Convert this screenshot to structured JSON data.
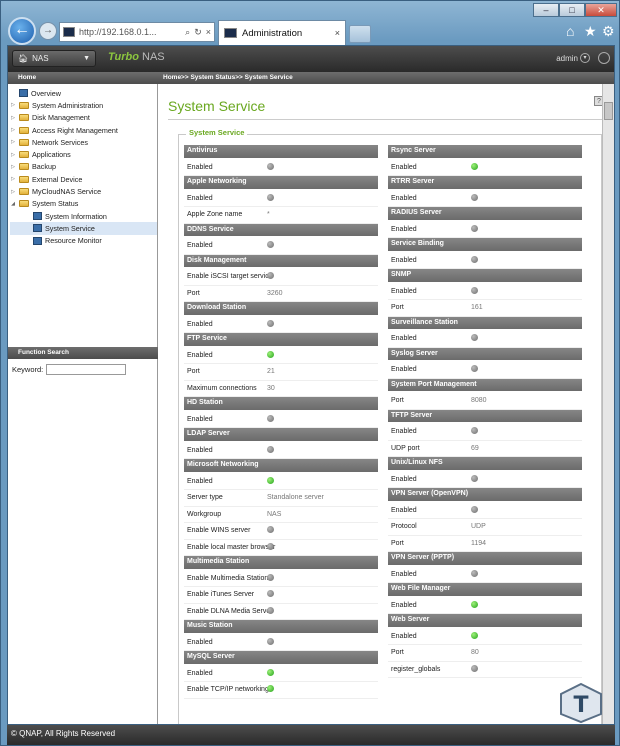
{
  "browser": {
    "address": "http://192.168.0.1...",
    "tab_title": "Administration",
    "tab_close": "×",
    "back": "←",
    "forward": "→",
    "reload": "↻",
    "search": "⌕",
    "addr_close": "×"
  },
  "header": {
    "nas_label": "NAS",
    "product_prefix": "Turbo",
    "product_name": "NAS",
    "user": "admin"
  },
  "breadcrumb": {
    "home": "Home",
    "path": "Home>> System Status>> System Service"
  },
  "sidebar": {
    "items": [
      {
        "label": "Overview",
        "tw": ""
      },
      {
        "label": "System Administration",
        "tw": "▷"
      },
      {
        "label": "Disk Management",
        "tw": "▷"
      },
      {
        "label": "Access Right Management",
        "tw": "▷"
      },
      {
        "label": "Network Services",
        "tw": "▷"
      },
      {
        "label": "Applications",
        "tw": "▷"
      },
      {
        "label": "Backup",
        "tw": "▷"
      },
      {
        "label": "External Device",
        "tw": "▷"
      },
      {
        "label": "MyCloudNAS Service",
        "tw": "▷"
      },
      {
        "label": "System Status",
        "tw": "◢"
      },
      {
        "label": "System Information",
        "tw": ""
      },
      {
        "label": "System Service",
        "tw": ""
      },
      {
        "label": "Resource Monitor",
        "tw": ""
      }
    ],
    "function_search": "Function Search",
    "keyword_label": "Keyword:"
  },
  "page": {
    "title": "System Service",
    "group_title": "System Service",
    "help": "?"
  },
  "left_sections": [
    {
      "title": "Antivirus",
      "rows": [
        {
          "label": "Enabled",
          "status": "off"
        }
      ]
    },
    {
      "title": "Apple Networking",
      "rows": [
        {
          "label": "Enabled",
          "status": "off"
        },
        {
          "label": "Apple Zone name",
          "value": "*"
        }
      ]
    },
    {
      "title": "DDNS Service",
      "rows": [
        {
          "label": "Enabled",
          "status": "off"
        }
      ]
    },
    {
      "title": "Disk Management",
      "rows": [
        {
          "label": "Enable iSCSI target service",
          "status": "off"
        },
        {
          "label": "Port",
          "value": "3260"
        }
      ]
    },
    {
      "title": "Download Station",
      "rows": [
        {
          "label": "Enabled",
          "status": "off"
        }
      ]
    },
    {
      "title": "FTP Service",
      "rows": [
        {
          "label": "Enabled",
          "status": "on"
        },
        {
          "label": "Port",
          "value": "21"
        },
        {
          "label": "Maximum connections",
          "value": "30"
        }
      ]
    },
    {
      "title": "HD Station",
      "rows": [
        {
          "label": "Enabled",
          "status": "off"
        }
      ]
    },
    {
      "title": "LDAP Server",
      "rows": [
        {
          "label": "Enabled",
          "status": "off"
        }
      ]
    },
    {
      "title": "Microsoft Networking",
      "rows": [
        {
          "label": "Enabled",
          "status": "on"
        },
        {
          "label": "Server type",
          "value": "Standalone server"
        },
        {
          "label": "Workgroup",
          "value": "NAS"
        },
        {
          "label": "Enable WINS server",
          "status": "off"
        },
        {
          "label": "Enable local master browser",
          "status": "off"
        }
      ]
    },
    {
      "title": "Multimedia Station",
      "rows": [
        {
          "label": "Enable Multimedia Station",
          "status": "off"
        },
        {
          "label": "Enable iTunes Server",
          "status": "off"
        },
        {
          "label": "Enable DLNA Media Server",
          "status": "off"
        }
      ]
    },
    {
      "title": "Music Station",
      "rows": [
        {
          "label": "Enabled",
          "status": "off"
        }
      ]
    },
    {
      "title": "MySQL Server",
      "rows": [
        {
          "label": "Enabled",
          "status": "on"
        },
        {
          "label": "Enable TCP/IP networking",
          "status": "on"
        }
      ]
    }
  ],
  "right_sections": [
    {
      "title": "Rsync Server",
      "rows": [
        {
          "label": "Enabled",
          "status": "on"
        }
      ]
    },
    {
      "title": "RTRR Server",
      "rows": [
        {
          "label": "Enabled",
          "status": "off"
        }
      ]
    },
    {
      "title": "RADIUS Server",
      "rows": [
        {
          "label": "Enabled",
          "status": "off"
        }
      ]
    },
    {
      "title": "Service Binding",
      "rows": [
        {
          "label": "Enabled",
          "status": "off"
        }
      ]
    },
    {
      "title": "SNMP",
      "rows": [
        {
          "label": "Enabled",
          "status": "off"
        },
        {
          "label": "Port",
          "value": "161"
        }
      ]
    },
    {
      "title": "Surveillance Station",
      "rows": [
        {
          "label": "Enabled",
          "status": "off"
        }
      ]
    },
    {
      "title": "Syslog Server",
      "rows": [
        {
          "label": "Enabled",
          "status": "off"
        }
      ]
    },
    {
      "title": "System Port Management",
      "rows": [
        {
          "label": "Port",
          "value": "8080"
        }
      ]
    },
    {
      "title": "TFTP Server",
      "rows": [
        {
          "label": "Enabled",
          "status": "off"
        },
        {
          "label": "UDP port",
          "value": "69"
        }
      ]
    },
    {
      "title": "Unix/Linux NFS",
      "rows": [
        {
          "label": "Enabled",
          "status": "off"
        }
      ]
    },
    {
      "title": "VPN Server (OpenVPN)",
      "rows": [
        {
          "label": "Enabled",
          "status": "off"
        },
        {
          "label": "Protocol",
          "value": "UDP"
        },
        {
          "label": "Port",
          "value": "1194"
        }
      ]
    },
    {
      "title": "VPN Server (PPTP)",
      "rows": [
        {
          "label": "Enabled",
          "status": "off"
        }
      ]
    },
    {
      "title": "Web File Manager",
      "rows": [
        {
          "label": "Enabled",
          "status": "on"
        }
      ]
    },
    {
      "title": "Web Server",
      "rows": [
        {
          "label": "Enabled",
          "status": "on"
        },
        {
          "label": "Port",
          "value": "80"
        },
        {
          "label": "register_globals",
          "status": "off"
        }
      ]
    }
  ],
  "footer": {
    "text": "© QNAP, All Rights Reserved"
  },
  "colors": {
    "accent_green": "#6aa820",
    "status_on": "#23a31a",
    "status_off": "#6e6e6e"
  }
}
